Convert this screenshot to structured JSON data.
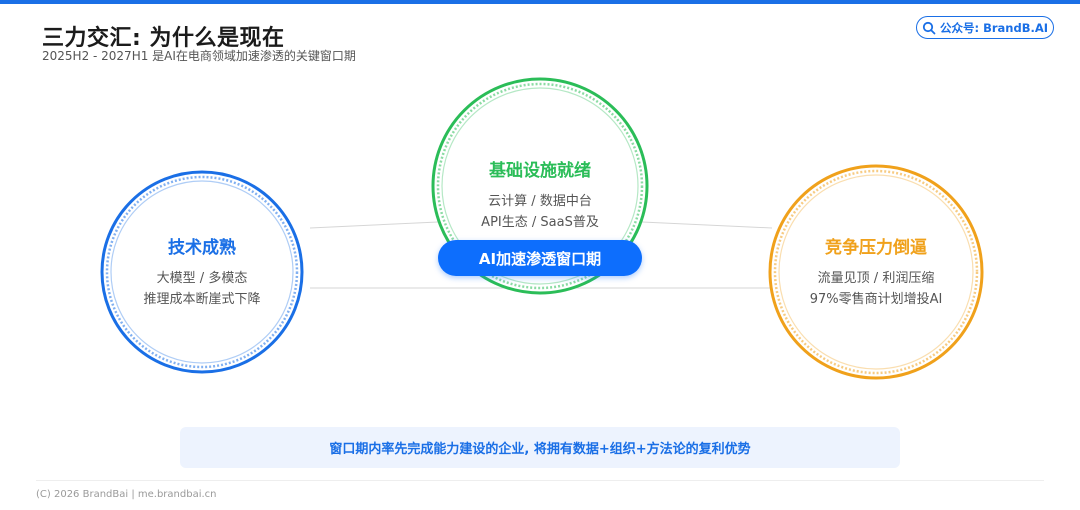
{
  "header": {
    "title": "三力交汇: 为什么是现在",
    "subtitle": "2025H2 - 2027H1 是AI在电商领域加速渗透的关键窗口期",
    "badge_label": "公众号: BrandB.AI",
    "badge_icon": "search-icon"
  },
  "colors": {
    "blue": "#1a6fe6",
    "green": "#2bbd58",
    "orange": "#f0a11b",
    "pill": "#0d6efd"
  },
  "nodes": {
    "left": {
      "title": "技术成熟",
      "lines": [
        "大模型 / 多模态",
        "推理成本断崖式下降"
      ]
    },
    "top": {
      "title": "基础设施就绪",
      "lines": [
        "云计算 / 数据中台",
        "API生态 / SaaS普及"
      ]
    },
    "right": {
      "title": "竞争压力倒逼",
      "lines": [
        "流量见顶 / 利润压缩",
        "97%零售商计划增投AI"
      ]
    }
  },
  "center_pill": "AI加速渗透窗口期",
  "callout": "窗口期内率先完成能力建设的企业, 将拥有数据+组织+方法论的复利优势",
  "footer": "(C) 2026 BrandBai | me.brandbai.cn"
}
